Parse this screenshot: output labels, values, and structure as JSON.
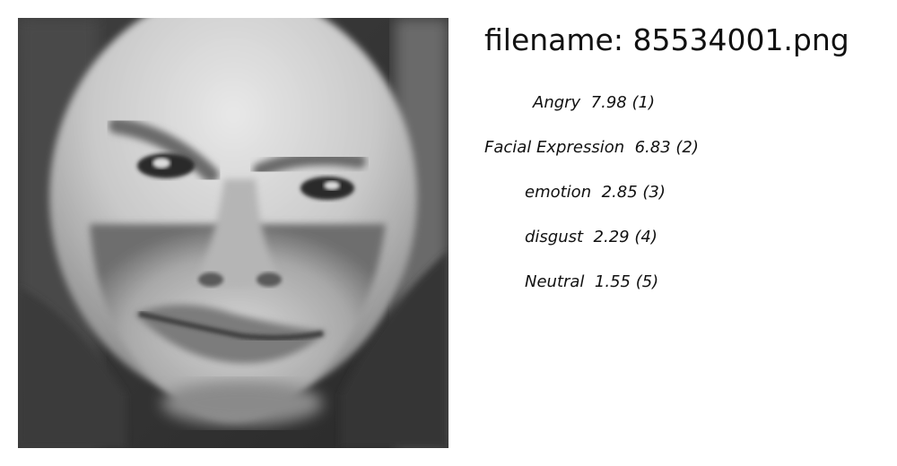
{
  "header": {
    "filename_prefix": "filename:",
    "filename": "85534001.png"
  },
  "labels": [
    {
      "name": "Angry",
      "score": "7.98",
      "rank": "(1)"
    },
    {
      "name": "Facial Expression",
      "score": "6.83",
      "rank": "(2)"
    },
    {
      "name": "emotion",
      "score": "2.85",
      "rank": "(3)"
    },
    {
      "name": "disgust",
      "score": "2.29",
      "rank": "(4)"
    },
    {
      "name": "Neutral",
      "score": "1.55",
      "rank": "(5)"
    }
  ]
}
